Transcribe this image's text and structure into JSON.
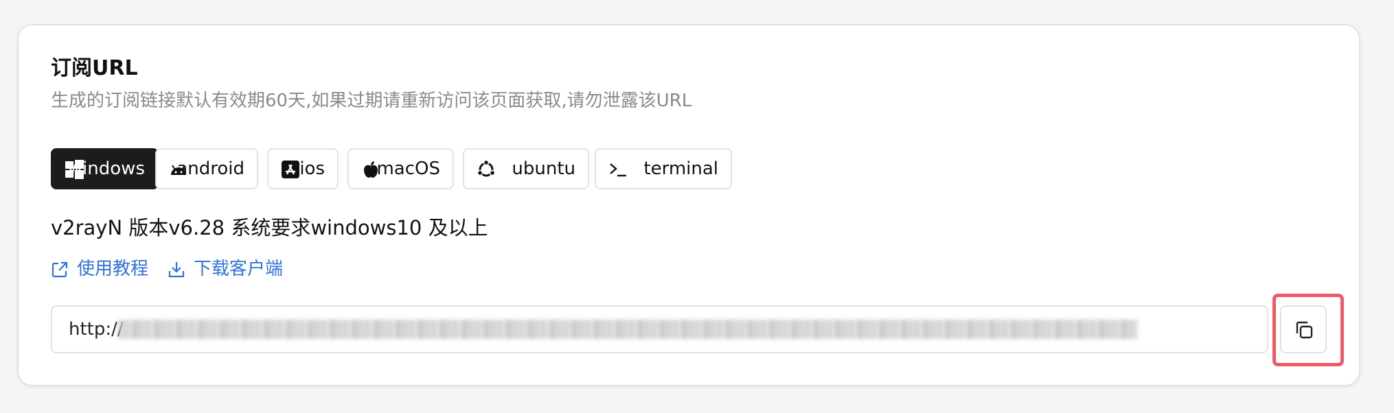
{
  "card": {
    "title": "订阅URL",
    "subtitle": "生成的订阅链接默认有效期60天,如果过期请重新访问该页面获取,请勿泄露该URL"
  },
  "tabs": [
    {
      "label": "windows",
      "icon": "windows-icon",
      "active": true
    },
    {
      "label": "android",
      "icon": "android-icon",
      "active": false
    },
    {
      "label": "ios",
      "icon": "app-store-icon",
      "active": false
    },
    {
      "label": "macOS",
      "icon": "apple-icon",
      "active": false
    },
    {
      "label": "ubuntu",
      "icon": "ubuntu-icon",
      "active": false
    },
    {
      "label": "terminal",
      "icon": "terminal-icon",
      "active": false
    }
  ],
  "info": "v2rayN 版本v6.28 系统要求windows10 及以上",
  "links": {
    "tutorial": {
      "label": "使用教程",
      "icon": "external-link-icon"
    },
    "download": {
      "label": "下载客户端",
      "icon": "download-icon"
    }
  },
  "url_field": {
    "prefix": "http://",
    "value_redacted": true
  },
  "copy_button": {
    "icon": "copy-icon"
  },
  "colors": {
    "link": "#2f73d9",
    "active_tab_bg": "#1c1c1c",
    "highlight": "#ec5a66",
    "subtitle": "#8a8a8a"
  }
}
